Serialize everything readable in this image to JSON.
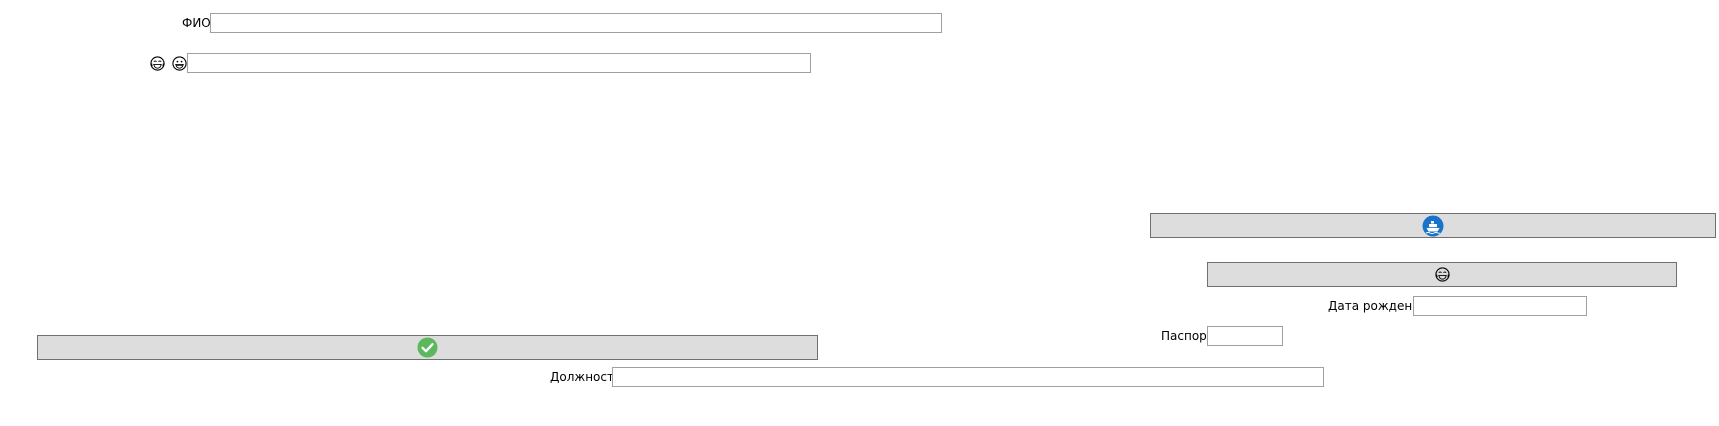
{
  "form": {
    "fio": {
      "label": "ФИО",
      "value": ""
    },
    "emoji_field": {
      "label_icons": [
        "face-with-tears-of-joy",
        "grinning-face"
      ],
      "value": ""
    },
    "birth_date": {
      "label": "Дата рождения",
      "value": ""
    },
    "passport": {
      "label": "Паспорт",
      "value": ""
    },
    "position": {
      "label": "Должность",
      "value": ""
    }
  },
  "buttons": {
    "cruise": {
      "icon": "cruise-ship-icon",
      "color": "#1a73c8"
    },
    "emoji": {
      "icon": "face-with-tears-of-joy"
    },
    "confirm": {
      "icon": "check-icon",
      "color": "#5cb85c"
    }
  }
}
